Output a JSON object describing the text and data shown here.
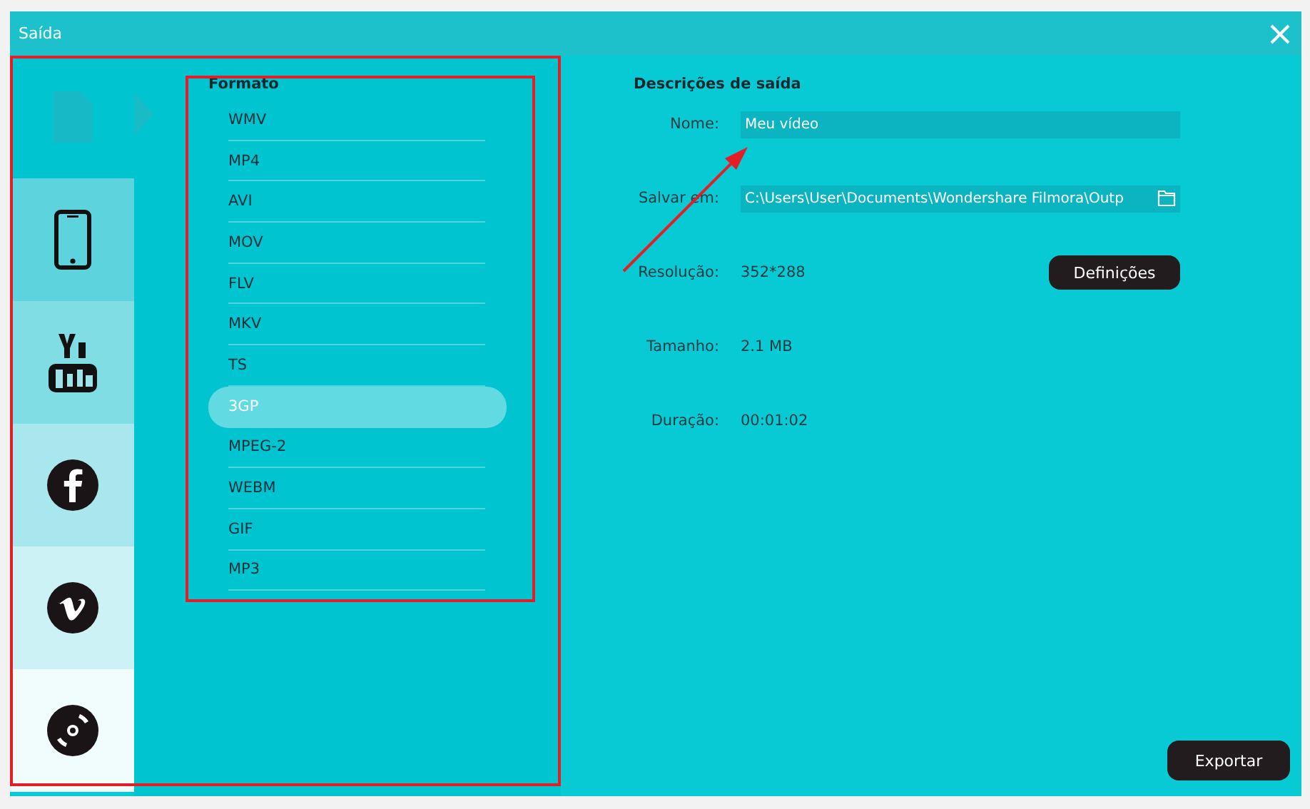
{
  "window": {
    "title": "Saída"
  },
  "sidebar": {
    "items": [
      {
        "kind": "file",
        "selected": true
      },
      {
        "kind": "phone",
        "selected": false
      },
      {
        "kind": "youtube",
        "selected": false
      },
      {
        "kind": "facebook",
        "selected": false
      },
      {
        "kind": "vimeo",
        "selected": false
      },
      {
        "kind": "disc",
        "selected": false
      }
    ]
  },
  "formats": {
    "title": "Formato",
    "items": [
      {
        "label": "WMV",
        "selected": false
      },
      {
        "label": "MP4",
        "selected": false
      },
      {
        "label": "AVI",
        "selected": false
      },
      {
        "label": "MOV",
        "selected": false
      },
      {
        "label": "FLV",
        "selected": false
      },
      {
        "label": "MKV",
        "selected": false
      },
      {
        "label": "TS",
        "selected": false
      },
      {
        "label": "3GP",
        "selected": true
      },
      {
        "label": "MPEG-2",
        "selected": false
      },
      {
        "label": "WEBM",
        "selected": false
      },
      {
        "label": "GIF",
        "selected": false
      },
      {
        "label": "MP3",
        "selected": false
      }
    ]
  },
  "output": {
    "title": "Descrições de saída",
    "rows": [
      {
        "kind": "input",
        "label": "Nome:",
        "value": "Meu vídeo"
      },
      {
        "kind": "path",
        "label": "Salvar em:",
        "value": "C:\\Users\\User\\Documents\\Wondershare Filmora\\Outp"
      },
      {
        "kind": "text",
        "label": "Resolução:",
        "value": "352*288",
        "button": "Definições"
      },
      {
        "kind": "text",
        "label": "Tamanho:",
        "value": "2.1 MB"
      },
      {
        "kind": "text",
        "label": "Duração:",
        "value": "00:01:02"
      }
    ]
  },
  "export_button": "Exportar",
  "annotations": [
    {
      "kind": "frame"
    },
    {
      "kind": "frame"
    },
    {
      "kind": "arrow"
    }
  ]
}
